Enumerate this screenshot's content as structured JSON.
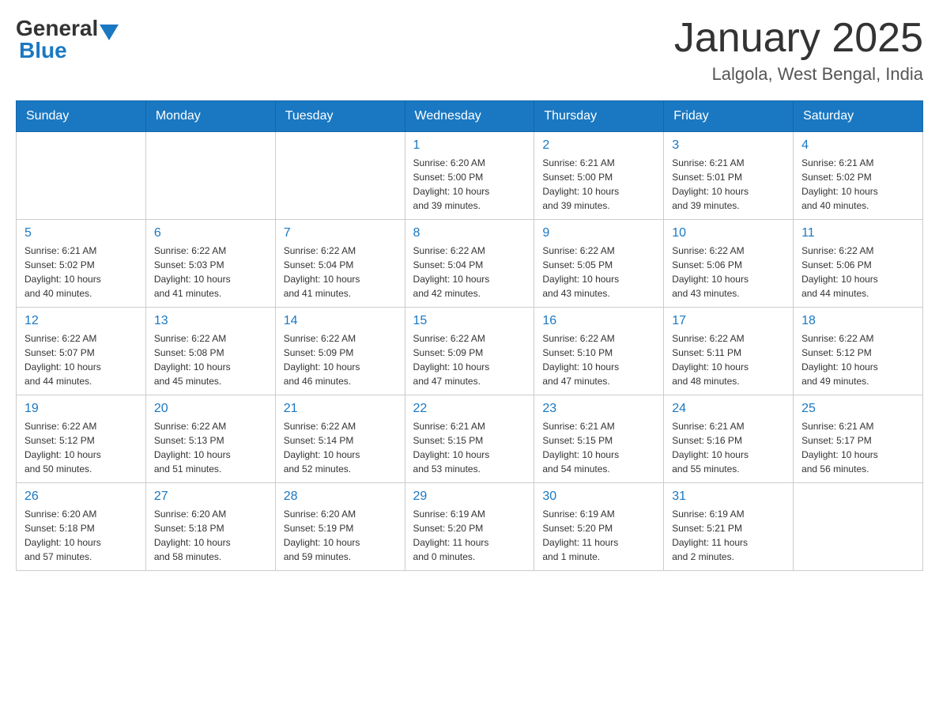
{
  "header": {
    "logo": {
      "general": "General",
      "blue": "Blue"
    },
    "title": "January 2025",
    "location": "Lalgola, West Bengal, India"
  },
  "days_of_week": [
    "Sunday",
    "Monday",
    "Tuesday",
    "Wednesday",
    "Thursday",
    "Friday",
    "Saturday"
  ],
  "weeks": [
    {
      "days": [
        {
          "number": "",
          "info": ""
        },
        {
          "number": "",
          "info": ""
        },
        {
          "number": "",
          "info": ""
        },
        {
          "number": "1",
          "info": "Sunrise: 6:20 AM\nSunset: 5:00 PM\nDaylight: 10 hours\nand 39 minutes."
        },
        {
          "number": "2",
          "info": "Sunrise: 6:21 AM\nSunset: 5:00 PM\nDaylight: 10 hours\nand 39 minutes."
        },
        {
          "number": "3",
          "info": "Sunrise: 6:21 AM\nSunset: 5:01 PM\nDaylight: 10 hours\nand 39 minutes."
        },
        {
          "number": "4",
          "info": "Sunrise: 6:21 AM\nSunset: 5:02 PM\nDaylight: 10 hours\nand 40 minutes."
        }
      ]
    },
    {
      "days": [
        {
          "number": "5",
          "info": "Sunrise: 6:21 AM\nSunset: 5:02 PM\nDaylight: 10 hours\nand 40 minutes."
        },
        {
          "number": "6",
          "info": "Sunrise: 6:22 AM\nSunset: 5:03 PM\nDaylight: 10 hours\nand 41 minutes."
        },
        {
          "number": "7",
          "info": "Sunrise: 6:22 AM\nSunset: 5:04 PM\nDaylight: 10 hours\nand 41 minutes."
        },
        {
          "number": "8",
          "info": "Sunrise: 6:22 AM\nSunset: 5:04 PM\nDaylight: 10 hours\nand 42 minutes."
        },
        {
          "number": "9",
          "info": "Sunrise: 6:22 AM\nSunset: 5:05 PM\nDaylight: 10 hours\nand 43 minutes."
        },
        {
          "number": "10",
          "info": "Sunrise: 6:22 AM\nSunset: 5:06 PM\nDaylight: 10 hours\nand 43 minutes."
        },
        {
          "number": "11",
          "info": "Sunrise: 6:22 AM\nSunset: 5:06 PM\nDaylight: 10 hours\nand 44 minutes."
        }
      ]
    },
    {
      "days": [
        {
          "number": "12",
          "info": "Sunrise: 6:22 AM\nSunset: 5:07 PM\nDaylight: 10 hours\nand 44 minutes."
        },
        {
          "number": "13",
          "info": "Sunrise: 6:22 AM\nSunset: 5:08 PM\nDaylight: 10 hours\nand 45 minutes."
        },
        {
          "number": "14",
          "info": "Sunrise: 6:22 AM\nSunset: 5:09 PM\nDaylight: 10 hours\nand 46 minutes."
        },
        {
          "number": "15",
          "info": "Sunrise: 6:22 AM\nSunset: 5:09 PM\nDaylight: 10 hours\nand 47 minutes."
        },
        {
          "number": "16",
          "info": "Sunrise: 6:22 AM\nSunset: 5:10 PM\nDaylight: 10 hours\nand 47 minutes."
        },
        {
          "number": "17",
          "info": "Sunrise: 6:22 AM\nSunset: 5:11 PM\nDaylight: 10 hours\nand 48 minutes."
        },
        {
          "number": "18",
          "info": "Sunrise: 6:22 AM\nSunset: 5:12 PM\nDaylight: 10 hours\nand 49 minutes."
        }
      ]
    },
    {
      "days": [
        {
          "number": "19",
          "info": "Sunrise: 6:22 AM\nSunset: 5:12 PM\nDaylight: 10 hours\nand 50 minutes."
        },
        {
          "number": "20",
          "info": "Sunrise: 6:22 AM\nSunset: 5:13 PM\nDaylight: 10 hours\nand 51 minutes."
        },
        {
          "number": "21",
          "info": "Sunrise: 6:22 AM\nSunset: 5:14 PM\nDaylight: 10 hours\nand 52 minutes."
        },
        {
          "number": "22",
          "info": "Sunrise: 6:21 AM\nSunset: 5:15 PM\nDaylight: 10 hours\nand 53 minutes."
        },
        {
          "number": "23",
          "info": "Sunrise: 6:21 AM\nSunset: 5:15 PM\nDaylight: 10 hours\nand 54 minutes."
        },
        {
          "number": "24",
          "info": "Sunrise: 6:21 AM\nSunset: 5:16 PM\nDaylight: 10 hours\nand 55 minutes."
        },
        {
          "number": "25",
          "info": "Sunrise: 6:21 AM\nSunset: 5:17 PM\nDaylight: 10 hours\nand 56 minutes."
        }
      ]
    },
    {
      "days": [
        {
          "number": "26",
          "info": "Sunrise: 6:20 AM\nSunset: 5:18 PM\nDaylight: 10 hours\nand 57 minutes."
        },
        {
          "number": "27",
          "info": "Sunrise: 6:20 AM\nSunset: 5:18 PM\nDaylight: 10 hours\nand 58 minutes."
        },
        {
          "number": "28",
          "info": "Sunrise: 6:20 AM\nSunset: 5:19 PM\nDaylight: 10 hours\nand 59 minutes."
        },
        {
          "number": "29",
          "info": "Sunrise: 6:19 AM\nSunset: 5:20 PM\nDaylight: 11 hours\nand 0 minutes."
        },
        {
          "number": "30",
          "info": "Sunrise: 6:19 AM\nSunset: 5:20 PM\nDaylight: 11 hours\nand 1 minute."
        },
        {
          "number": "31",
          "info": "Sunrise: 6:19 AM\nSunset: 5:21 PM\nDaylight: 11 hours\nand 2 minutes."
        },
        {
          "number": "",
          "info": ""
        }
      ]
    }
  ]
}
